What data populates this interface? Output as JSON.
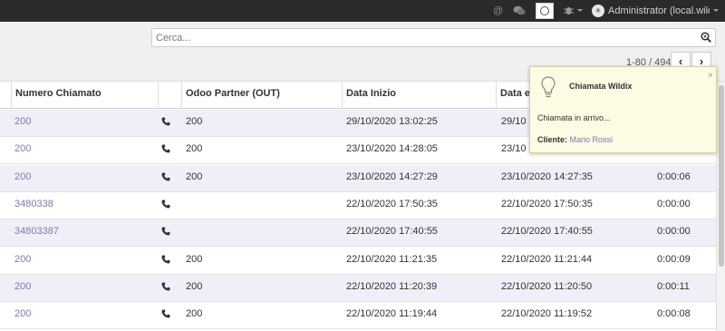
{
  "navbar": {
    "user": "Administrator (local.wild..."
  },
  "search": {
    "placeholder": "Cerca..."
  },
  "pager": {
    "range": "1-80 / 494",
    "prev": "‹",
    "next": "›"
  },
  "table": {
    "columns": [
      "Numero Chiamato",
      "Odoo Partner (OUT)",
      "Data Inizio",
      "Data e"
    ],
    "rows": [
      {
        "number": "200",
        "partner": "200",
        "start": "29/10/2020 13:02:25",
        "end": "29/10",
        "duration": ""
      },
      {
        "number": "200",
        "partner": "200",
        "start": "23/10/2020 14:28:05",
        "end": "23/10",
        "duration": ""
      },
      {
        "number": "200",
        "partner": "200",
        "start": "23/10/2020 14:27:29",
        "end": "23/10/2020 14:27:35",
        "duration": "0:00:06"
      },
      {
        "number": "3480338",
        "partner": "",
        "start": "22/10/2020 17:50:35",
        "end": "22/10/2020 17:50:35",
        "duration": "0:00:00"
      },
      {
        "number": "34803387",
        "partner": "",
        "start": "22/10/2020 17:40:55",
        "end": "22/10/2020 17:40:55",
        "duration": "0:00:00"
      },
      {
        "number": "200",
        "partner": "200",
        "start": "22/10/2020 11:21:35",
        "end": "22/10/2020 11:21:44",
        "duration": "0:00:09"
      },
      {
        "number": "200",
        "partner": "200",
        "start": "22/10/2020 11:20:39",
        "end": "22/10/2020 11:20:50",
        "duration": "0:00:11"
      },
      {
        "number": "200",
        "partner": "200",
        "start": "22/10/2020 11:19:44",
        "end": "22/10/2020 11:19:52",
        "duration": "0:00:08"
      }
    ]
  },
  "notification": {
    "title": "Chiamata Wildix",
    "close": "×",
    "message": "Chiamata in arrivo...",
    "client_label": "Cliente:",
    "client_name": "Mario Rossi"
  },
  "colors": {
    "navbar_bg": "#2a2a2a",
    "link": "#7c7bad",
    "row_alt": "#efeff8",
    "notification_bg": "#fcfbe3"
  }
}
